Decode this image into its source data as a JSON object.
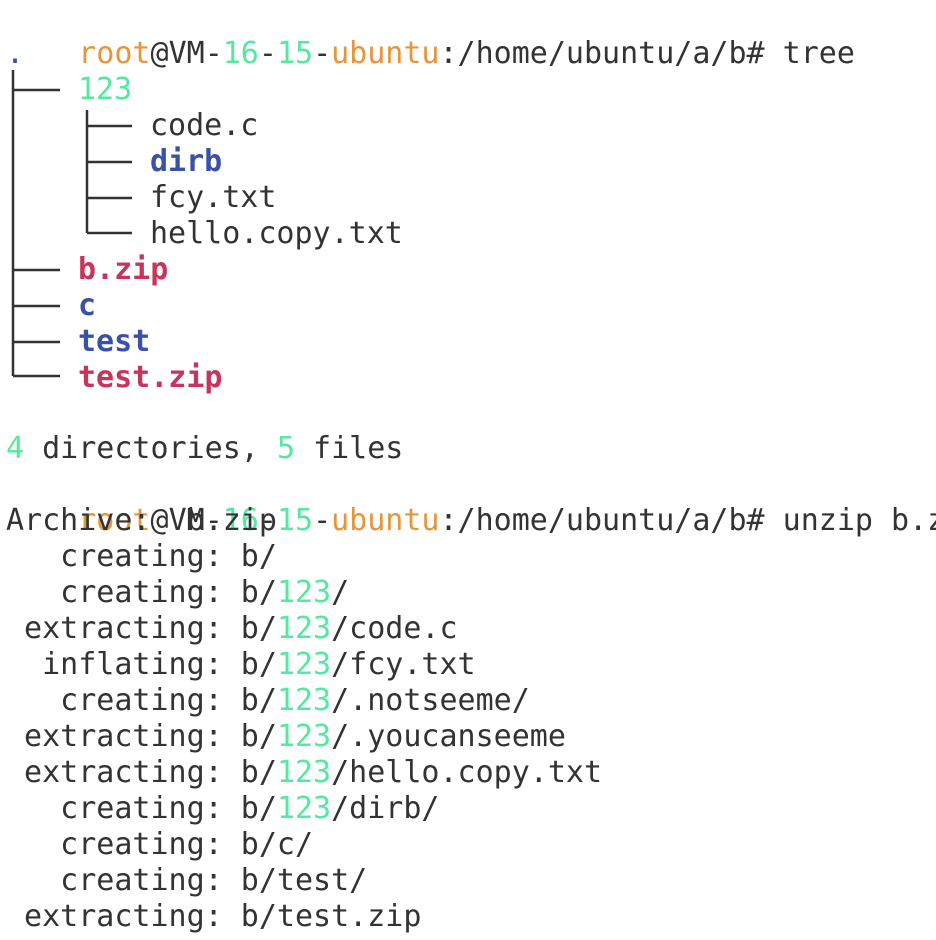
{
  "prompt": {
    "user": "root",
    "at": "@",
    "host_parts": [
      "VM",
      "16",
      "15",
      "ubuntu"
    ],
    "host_sep": "-",
    "path": ":/home/ubuntu/a/b#"
  },
  "commands": {
    "tree": " tree",
    "unzip": " unzip b.zip"
  },
  "tree": {
    "root": ".",
    "top_dir": "123",
    "nested": [
      {
        "name": "code.c",
        "kind": "file"
      },
      {
        "name": "dirb",
        "kind": "dir"
      },
      {
        "name": "fcy.txt",
        "kind": "file"
      },
      {
        "name": "hello.copy.txt",
        "kind": "file"
      }
    ],
    "rest": [
      {
        "name": "b.zip",
        "kind": "archive"
      },
      {
        "name": "c",
        "kind": "dir"
      },
      {
        "name": "test",
        "kind": "dir"
      },
      {
        "name": "test.zip",
        "kind": "archive"
      }
    ],
    "summary": {
      "dirs": "4",
      "dirs_label": " directories, ",
      "files": "5",
      "files_label": " files"
    }
  },
  "unzip": {
    "archive_label": "Archive:  b.zip",
    "entries": [
      {
        "action": "   creating:",
        "prefix": " b/",
        "hl": "",
        "suffix": ""
      },
      {
        "action": "   creating:",
        "prefix": " b/",
        "hl": "123",
        "suffix": "/"
      },
      {
        "action": " extracting:",
        "prefix": " b/",
        "hl": "123",
        "suffix": "/code.c"
      },
      {
        "action": "  inflating:",
        "prefix": " b/",
        "hl": "123",
        "suffix": "/fcy.txt"
      },
      {
        "action": "   creating:",
        "prefix": " b/",
        "hl": "123",
        "suffix": "/.notseeme/"
      },
      {
        "action": " extracting:",
        "prefix": " b/",
        "hl": "123",
        "suffix": "/.youcanseeme"
      },
      {
        "action": " extracting:",
        "prefix": " b/",
        "hl": "123",
        "suffix": "/hello.copy.txt"
      },
      {
        "action": "   creating:",
        "prefix": " b/",
        "hl": "123",
        "suffix": "/dirb/"
      },
      {
        "action": "   creating:",
        "prefix": " b/c/",
        "hl": "",
        "suffix": ""
      },
      {
        "action": "   creating:",
        "prefix": " b/test/",
        "hl": "",
        "suffix": ""
      },
      {
        "action": " extracting:",
        "prefix": " b/test.zip",
        "hl": "",
        "suffix": ""
      }
    ]
  },
  "colors": {
    "user": "#e8953a",
    "host_number": "#55e8a0",
    "directory": "#3a51a8",
    "archive": "#c8345d",
    "text": "#333333",
    "background": "#ffffff"
  }
}
